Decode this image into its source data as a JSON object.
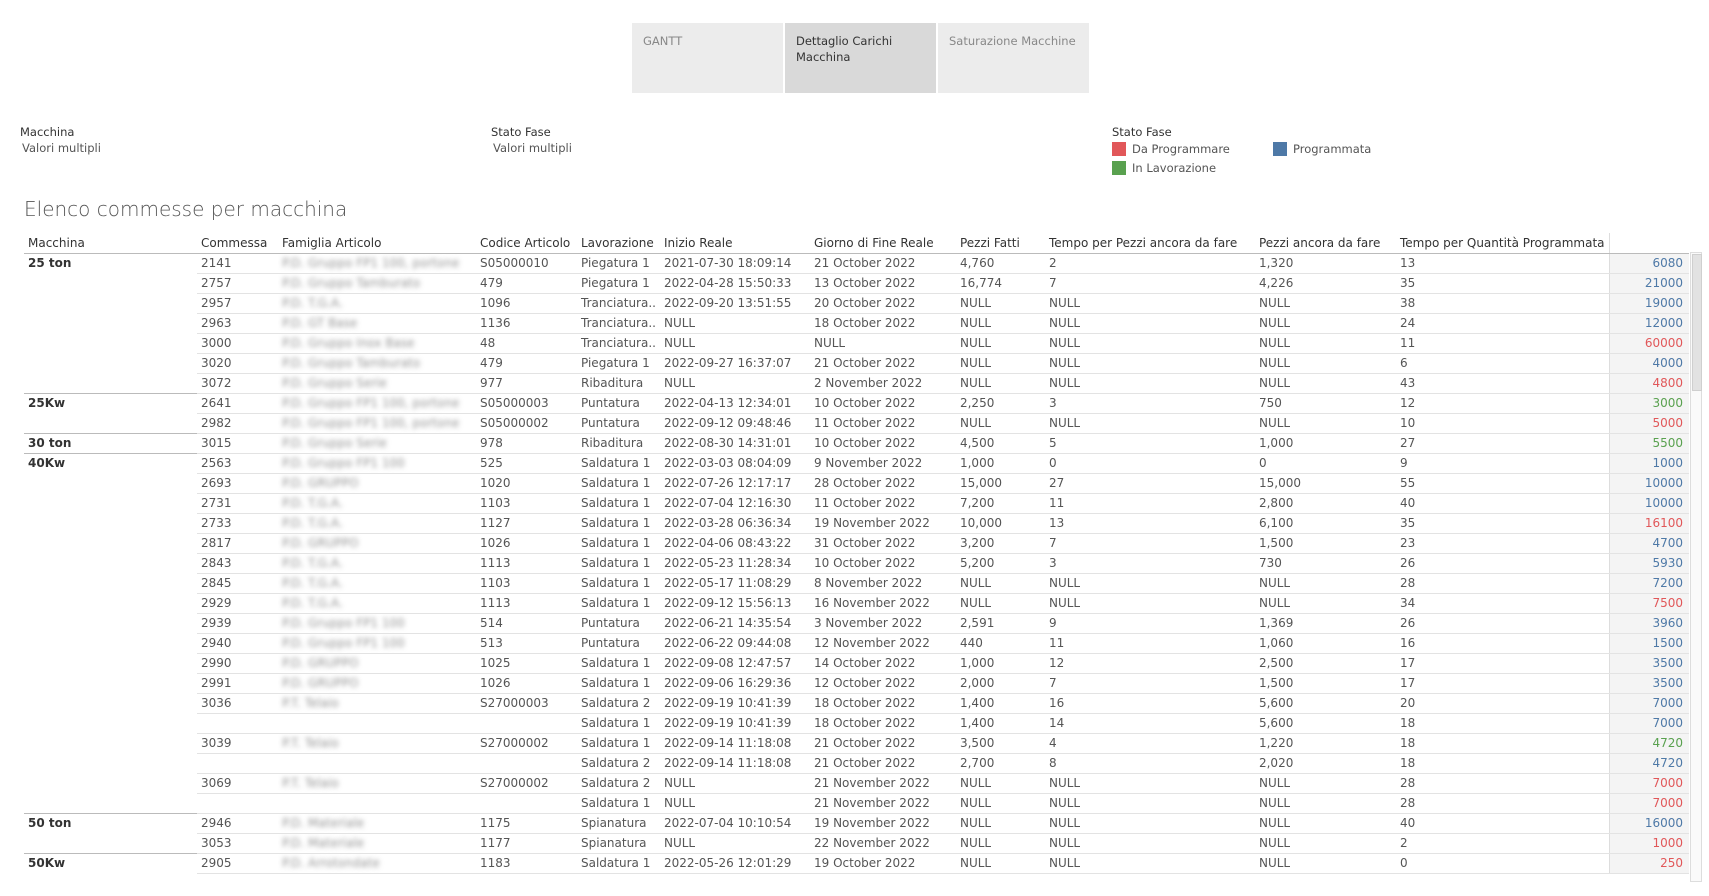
{
  "tabs": [
    {
      "label": "GANTT",
      "active": false
    },
    {
      "label": "Dettaglio Carichi Macchina",
      "active": true
    },
    {
      "label": "Saturazione Macchine",
      "active": false
    }
  ],
  "filters": [
    {
      "title": "Macchina",
      "value": "Valori multipli"
    },
    {
      "title": "Stato Fase",
      "value": "Valori multipli"
    }
  ],
  "legend": {
    "title": "Stato Fase",
    "items": [
      {
        "label": "Da Programmare",
        "color": "#e15759"
      },
      {
        "label": "Programmata",
        "color": "#4e79a7"
      },
      {
        "label": "In Lavorazione",
        "color": "#59a14f"
      }
    ]
  },
  "sheet_title": "Elenco commesse per macchina",
  "table": {
    "headers": [
      "Macchina",
      "Commessa",
      "Famiglia Articolo",
      "Codice Articolo",
      "Lavorazione",
      "Inizio Reale",
      "Giorno di Fine Reale",
      "Pezzi Fatti",
      "Tempo per Pezzi ancora da fare",
      "Pezzi ancora da fare",
      "Tempo per Quantità Programmata",
      ""
    ],
    "rows": [
      {
        "macchina": "25 ton",
        "commessa": "2141",
        "famiglia": "P.D. Gruppo FP1 100, portone",
        "codice": "S05000010",
        "lavorazione": "Piegatura 1",
        "inizio": "2021-07-30 18:09:14",
        "fine": "21 October 2022",
        "pezzi_fatti": "4,760",
        "tempo_pezzi": "2",
        "pezzi_da_fare": "1,320",
        "tempo_qta": "13",
        "valore": "6080",
        "stato": "Programmata"
      },
      {
        "macchina": "",
        "commessa": "2757",
        "famiglia": "P.D. Gruppo Tamburato",
        "codice": "479",
        "lavorazione": "Piegatura 1",
        "inizio": "2022-04-28 15:50:33",
        "fine": "13 October 2022",
        "pezzi_fatti": "16,774",
        "tempo_pezzi": "7",
        "pezzi_da_fare": "4,226",
        "tempo_qta": "35",
        "valore": "21000",
        "stato": "Programmata"
      },
      {
        "macchina": "",
        "commessa": "2957",
        "famiglia": "P.D. T.G.A.",
        "codice": "1096",
        "lavorazione": "Tranciatura..",
        "inizio": "2022-09-20 13:51:55",
        "fine": "20 October 2022",
        "pezzi_fatti": "NULL",
        "tempo_pezzi": "NULL",
        "pezzi_da_fare": "NULL",
        "tempo_qta": "38",
        "valore": "19000",
        "stato": "Programmata"
      },
      {
        "macchina": "",
        "commessa": "2963",
        "famiglia": "P.D. GT Base",
        "codice": "1136",
        "lavorazione": "Tranciatura..",
        "inizio": "NULL",
        "fine": "18 October 2022",
        "pezzi_fatti": "NULL",
        "tempo_pezzi": "NULL",
        "pezzi_da_fare": "NULL",
        "tempo_qta": "24",
        "valore": "12000",
        "stato": "Programmata"
      },
      {
        "macchina": "",
        "commessa": "3000",
        "famiglia": "P.D. Gruppo Inox Base",
        "codice": "48",
        "lavorazione": "Tranciatura..",
        "inizio": "NULL",
        "fine": "NULL",
        "pezzi_fatti": "NULL",
        "tempo_pezzi": "NULL",
        "pezzi_da_fare": "NULL",
        "tempo_qta": "11",
        "valore": "60000",
        "stato": "Da Programmare"
      },
      {
        "macchina": "",
        "commessa": "3020",
        "famiglia": "P.D. Gruppo Tamburato",
        "codice": "479",
        "lavorazione": "Piegatura 1",
        "inizio": "2022-09-27 16:37:07",
        "fine": "21 October 2022",
        "pezzi_fatti": "NULL",
        "tempo_pezzi": "NULL",
        "pezzi_da_fare": "NULL",
        "tempo_qta": "6",
        "valore": "4000",
        "stato": "Programmata"
      },
      {
        "macchina": "",
        "commessa": "3072",
        "famiglia": "P.D. Gruppo Serie",
        "codice": "977",
        "lavorazione": "Ribaditura",
        "inizio": "NULL",
        "fine": "2 November 2022",
        "pezzi_fatti": "NULL",
        "tempo_pezzi": "NULL",
        "pezzi_da_fare": "NULL",
        "tempo_qta": "43",
        "valore": "4800",
        "stato": "Da Programmare"
      },
      {
        "macchina": "25Kw",
        "commessa": "2641",
        "famiglia": "P.D. Gruppo FP1 100, portone",
        "codice": "S05000003",
        "lavorazione": "Puntatura",
        "inizio": "2022-04-13 12:34:01",
        "fine": "10 October 2022",
        "pezzi_fatti": "2,250",
        "tempo_pezzi": "3",
        "pezzi_da_fare": "750",
        "tempo_qta": "12",
        "valore": "3000",
        "stato": "In Lavorazione"
      },
      {
        "macchina": "",
        "commessa": "2982",
        "famiglia": "P.D. Gruppo FP1 100, portone",
        "codice": "S05000002",
        "lavorazione": "Puntatura",
        "inizio": "2022-09-12 09:48:46",
        "fine": "11 October 2022",
        "pezzi_fatti": "NULL",
        "tempo_pezzi": "NULL",
        "pezzi_da_fare": "NULL",
        "tempo_qta": "10",
        "valore": "5000",
        "stato": "Da Programmare"
      },
      {
        "macchina": "30 ton",
        "commessa": "3015",
        "famiglia": "P.D. Gruppo Serie",
        "codice": "978",
        "lavorazione": "Ribaditura",
        "inizio": "2022-08-30 14:31:01",
        "fine": "10 October 2022",
        "pezzi_fatti": "4,500",
        "tempo_pezzi": "5",
        "pezzi_da_fare": "1,000",
        "tempo_qta": "27",
        "valore": "5500",
        "stato": "In Lavorazione"
      },
      {
        "macchina": "40Kw",
        "commessa": "2563",
        "famiglia": "P.D. Gruppo FP1 100",
        "codice": "525",
        "lavorazione": "Saldatura 1",
        "inizio": "2022-03-03 08:04:09",
        "fine": "9 November 2022",
        "pezzi_fatti": "1,000",
        "tempo_pezzi": "0",
        "pezzi_da_fare": "0",
        "tempo_qta": "9",
        "valore": "1000",
        "stato": "Programmata"
      },
      {
        "macchina": "",
        "commessa": "2693",
        "famiglia": "P.D. GRUPPO",
        "codice": "1020",
        "lavorazione": "Saldatura 1",
        "inizio": "2022-07-26 12:17:17",
        "fine": "28 October 2022",
        "pezzi_fatti": "15,000",
        "tempo_pezzi": "27",
        "pezzi_da_fare": "15,000",
        "tempo_qta": "55",
        "valore": "10000",
        "stato": "Programmata"
      },
      {
        "macchina": "",
        "commessa": "2731",
        "famiglia": "P.D. T.G.A.",
        "codice": "1103",
        "lavorazione": "Saldatura 1",
        "inizio": "2022-07-04 12:16:30",
        "fine": "11 October 2022",
        "pezzi_fatti": "7,200",
        "tempo_pezzi": "11",
        "pezzi_da_fare": "2,800",
        "tempo_qta": "40",
        "valore": "10000",
        "stato": "Programmata"
      },
      {
        "macchina": "",
        "commessa": "2733",
        "famiglia": "P.D. T.G.A.",
        "codice": "1127",
        "lavorazione": "Saldatura 1",
        "inizio": "2022-03-28 06:36:34",
        "fine": "19 November 2022",
        "pezzi_fatti": "10,000",
        "tempo_pezzi": "13",
        "pezzi_da_fare": "6,100",
        "tempo_qta": "35",
        "valore": "16100",
        "stato": "Da Programmare"
      },
      {
        "macchina": "",
        "commessa": "2817",
        "famiglia": "P.D. GRUPPO",
        "codice": "1026",
        "lavorazione": "Saldatura 1",
        "inizio": "2022-04-06 08:43:22",
        "fine": "31 October 2022",
        "pezzi_fatti": "3,200",
        "tempo_pezzi": "7",
        "pezzi_da_fare": "1,500",
        "tempo_qta": "23",
        "valore": "4700",
        "stato": "Programmata"
      },
      {
        "macchina": "",
        "commessa": "2843",
        "famiglia": "P.D. T.G.A.",
        "codice": "1113",
        "lavorazione": "Saldatura 1",
        "inizio": "2022-05-23 11:28:34",
        "fine": "10 October 2022",
        "pezzi_fatti": "5,200",
        "tempo_pezzi": "3",
        "pezzi_da_fare": "730",
        "tempo_qta": "26",
        "valore": "5930",
        "stato": "Programmata"
      },
      {
        "macchina": "",
        "commessa": "2845",
        "famiglia": "P.D. T.G.A.",
        "codice": "1103",
        "lavorazione": "Saldatura 1",
        "inizio": "2022-05-17 11:08:29",
        "fine": "8 November 2022",
        "pezzi_fatti": "NULL",
        "tempo_pezzi": "NULL",
        "pezzi_da_fare": "NULL",
        "tempo_qta": "28",
        "valore": "7200",
        "stato": "Programmata"
      },
      {
        "macchina": "",
        "commessa": "2929",
        "famiglia": "P.D. T.G.A.",
        "codice": "1113",
        "lavorazione": "Saldatura 1",
        "inizio": "2022-09-12 15:56:13",
        "fine": "16 November 2022",
        "pezzi_fatti": "NULL",
        "tempo_pezzi": "NULL",
        "pezzi_da_fare": "NULL",
        "tempo_qta": "34",
        "valore": "7500",
        "stato": "Da Programmare"
      },
      {
        "macchina": "",
        "commessa": "2939",
        "famiglia": "P.D. Gruppo FP1 100",
        "codice": "514",
        "lavorazione": "Puntatura",
        "inizio": "2022-06-21 14:35:54",
        "fine": "3 November 2022",
        "pezzi_fatti": "2,591",
        "tempo_pezzi": "9",
        "pezzi_da_fare": "1,369",
        "tempo_qta": "26",
        "valore": "3960",
        "stato": "Programmata"
      },
      {
        "macchina": "",
        "commessa": "2940",
        "famiglia": "P.D. Gruppo FP1 100",
        "codice": "513",
        "lavorazione": "Puntatura",
        "inizio": "2022-06-22 09:44:08",
        "fine": "12 November 2022",
        "pezzi_fatti": "440",
        "tempo_pezzi": "11",
        "pezzi_da_fare": "1,060",
        "tempo_qta": "16",
        "valore": "1500",
        "stato": "Programmata"
      },
      {
        "macchina": "",
        "commessa": "2990",
        "famiglia": "P.D. GRUPPO",
        "codice": "1025",
        "lavorazione": "Saldatura 1",
        "inizio": "2022-09-08 12:47:57",
        "fine": "14 October 2022",
        "pezzi_fatti": "1,000",
        "tempo_pezzi": "12",
        "pezzi_da_fare": "2,500",
        "tempo_qta": "17",
        "valore": "3500",
        "stato": "Programmata"
      },
      {
        "macchina": "",
        "commessa": "2991",
        "famiglia": "P.D. GRUPPO",
        "codice": "1026",
        "lavorazione": "Saldatura 1",
        "inizio": "2022-09-06 16:29:36",
        "fine": "12 October 2022",
        "pezzi_fatti": "2,000",
        "tempo_pezzi": "7",
        "pezzi_da_fare": "1,500",
        "tempo_qta": "17",
        "valore": "3500",
        "stato": "Programmata"
      },
      {
        "macchina": "",
        "commessa": "3036",
        "famiglia": "P.T. Telaio",
        "codice": "S27000003",
        "lavorazione": "Saldatura 2",
        "inizio": "2022-09-19 10:41:39",
        "fine": "18 October 2022",
        "pezzi_fatti": "1,400",
        "tempo_pezzi": "16",
        "pezzi_da_fare": "5,600",
        "tempo_qta": "20",
        "valore": "7000",
        "stato": "Programmata"
      },
      {
        "macchina": "",
        "commessa": "",
        "famiglia": "",
        "codice": "",
        "lavorazione": "Saldatura 1",
        "inizio": "2022-09-19 10:41:39",
        "fine": "18 October 2022",
        "pezzi_fatti": "1,400",
        "tempo_pezzi": "14",
        "pezzi_da_fare": "5,600",
        "tempo_qta": "18",
        "valore": "7000",
        "stato": "Programmata"
      },
      {
        "macchina": "",
        "commessa": "3039",
        "famiglia": "P.T. Telaio",
        "codice": "S27000002",
        "lavorazione": "Saldatura 1",
        "inizio": "2022-09-14 11:18:08",
        "fine": "21 October 2022",
        "pezzi_fatti": "3,500",
        "tempo_pezzi": "4",
        "pezzi_da_fare": "1,220",
        "tempo_qta": "18",
        "valore": "4720",
        "stato": "In Lavorazione"
      },
      {
        "macchina": "",
        "commessa": "",
        "famiglia": "",
        "codice": "",
        "lavorazione": "Saldatura 2",
        "inizio": "2022-09-14 11:18:08",
        "fine": "21 October 2022",
        "pezzi_fatti": "2,700",
        "tempo_pezzi": "8",
        "pezzi_da_fare": "2,020",
        "tempo_qta": "18",
        "valore": "4720",
        "stato": "Programmata"
      },
      {
        "macchina": "",
        "commessa": "3069",
        "famiglia": "P.T. Telaio",
        "codice": "S27000002",
        "lavorazione": "Saldatura 2",
        "inizio": "NULL",
        "fine": "21 November 2022",
        "pezzi_fatti": "NULL",
        "tempo_pezzi": "NULL",
        "pezzi_da_fare": "NULL",
        "tempo_qta": "28",
        "valore": "7000",
        "stato": "Da Programmare"
      },
      {
        "macchina": "",
        "commessa": "",
        "famiglia": "",
        "codice": "",
        "lavorazione": "Saldatura 1",
        "inizio": "NULL",
        "fine": "21 November 2022",
        "pezzi_fatti": "NULL",
        "tempo_pezzi": "NULL",
        "pezzi_da_fare": "NULL",
        "tempo_qta": "28",
        "valore": "7000",
        "stato": "Da Programmare"
      },
      {
        "macchina": "50 ton",
        "commessa": "2946",
        "famiglia": "P.D. Materiale",
        "codice": "1175",
        "lavorazione": "Spianatura",
        "inizio": "2022-07-04 10:10:54",
        "fine": "19 November 2022",
        "pezzi_fatti": "NULL",
        "tempo_pezzi": "NULL",
        "pezzi_da_fare": "NULL",
        "tempo_qta": "40",
        "valore": "16000",
        "stato": "Programmata"
      },
      {
        "macchina": "",
        "commessa": "3053",
        "famiglia": "P.D. Materiale",
        "codice": "1177",
        "lavorazione": "Spianatura",
        "inizio": "NULL",
        "fine": "22 November 2022",
        "pezzi_fatti": "NULL",
        "tempo_pezzi": "NULL",
        "pezzi_da_fare": "NULL",
        "tempo_qta": "2",
        "valore": "1000",
        "stato": "Da Programmare"
      },
      {
        "macchina": "50Kw",
        "commessa": "2905",
        "famiglia": "P.D. Arrotondate",
        "codice": "1183",
        "lavorazione": "Saldatura 1",
        "inizio": "2022-05-26 12:01:29",
        "fine": "19 October 2022",
        "pezzi_fatti": "NULL",
        "tempo_pezzi": "NULL",
        "pezzi_da_fare": "NULL",
        "tempo_qta": "0",
        "valore": "250",
        "stato": "Da Programmare"
      }
    ]
  }
}
